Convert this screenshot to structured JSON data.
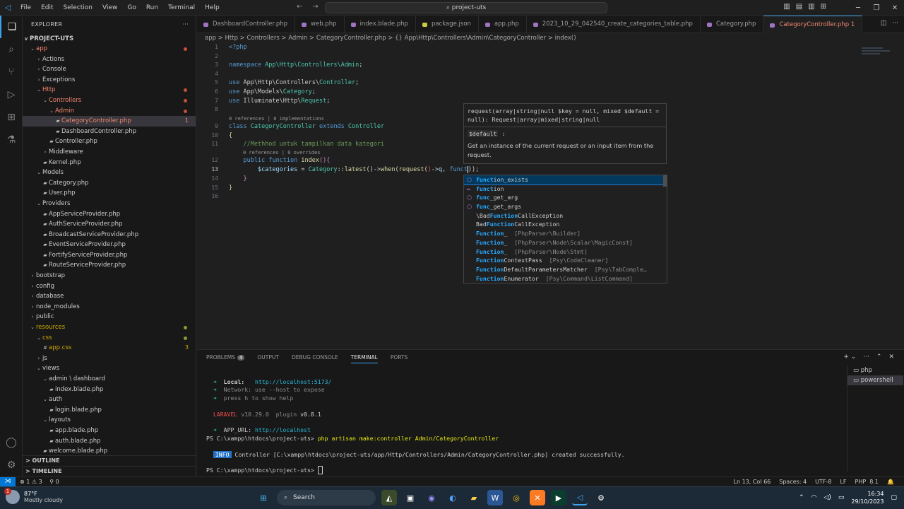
{
  "titlebar": {
    "menu": [
      "File",
      "Edit",
      "Selection",
      "View",
      "Go",
      "Run",
      "Terminal",
      "Help"
    ],
    "search": "project-uts"
  },
  "explorer": {
    "title": "EXPLORER",
    "project": "PROJECT-UTS",
    "tree": [
      {
        "label": "app",
        "indent": 1,
        "chev": "v",
        "cls": "red",
        "dot": "#c74e39"
      },
      {
        "label": "Actions",
        "indent": 2,
        "chev": ">"
      },
      {
        "label": "Console",
        "indent": 2,
        "chev": ">"
      },
      {
        "label": "Exceptions",
        "indent": 2,
        "chev": ">"
      },
      {
        "label": "Http",
        "indent": 2,
        "chev": "v",
        "cls": "red",
        "dot": "#c74e39"
      },
      {
        "label": "Controllers",
        "indent": 3,
        "chev": "v",
        "cls": "red",
        "dot": "#c74e39"
      },
      {
        "label": "Admin",
        "indent": 4,
        "chev": "v",
        "cls": "red",
        "dot": "#c74e39"
      },
      {
        "label": "CategoryController.php",
        "indent": 5,
        "file": "php",
        "cls": "red",
        "num": "1",
        "sel": true
      },
      {
        "label": "DashboardController.php",
        "indent": 5,
        "file": "php"
      },
      {
        "label": "Controller.php",
        "indent": 4,
        "file": "php"
      },
      {
        "label": "Middleware",
        "indent": 3,
        "chev": ">"
      },
      {
        "label": "Kernel.php",
        "indent": 3,
        "file": "php"
      },
      {
        "label": "Models",
        "indent": 2,
        "chev": "v"
      },
      {
        "label": "Category.php",
        "indent": 3,
        "file": "php"
      },
      {
        "label": "User.php",
        "indent": 3,
        "file": "php"
      },
      {
        "label": "Providers",
        "indent": 2,
        "chev": "v"
      },
      {
        "label": "AppServiceProvider.php",
        "indent": 3,
        "file": "php"
      },
      {
        "label": "AuthServiceProvider.php",
        "indent": 3,
        "file": "php"
      },
      {
        "label": "BroadcastServiceProvider.php",
        "indent": 3,
        "file": "php"
      },
      {
        "label": "EventServiceProvider.php",
        "indent": 3,
        "file": "php"
      },
      {
        "label": "FortifyServiceProvider.php",
        "indent": 3,
        "file": "php"
      },
      {
        "label": "RouteServiceProvider.php",
        "indent": 3,
        "file": "php"
      },
      {
        "label": "bootstrap",
        "indent": 1,
        "chev": ">"
      },
      {
        "label": "config",
        "indent": 1,
        "chev": ">"
      },
      {
        "label": "database",
        "indent": 1,
        "chev": ">"
      },
      {
        "label": "node_modules",
        "indent": 1,
        "chev": ">"
      },
      {
        "label": "public",
        "indent": 1,
        "chev": ">"
      },
      {
        "label": "resources",
        "indent": 1,
        "chev": "v",
        "cls": "yel",
        "dot": "#8f9a2e"
      },
      {
        "label": "css",
        "indent": 2,
        "chev": "v",
        "cls": "yel",
        "dot": "#8f9a2e"
      },
      {
        "label": "app.css",
        "indent": 3,
        "file": "css",
        "cls": "yel",
        "num": "3"
      },
      {
        "label": "js",
        "indent": 2,
        "chev": ">"
      },
      {
        "label": "views",
        "indent": 2,
        "chev": "v"
      },
      {
        "label": "admin \\ dashboard",
        "indent": 3,
        "chev": "v"
      },
      {
        "label": "index.blade.php",
        "indent": 4,
        "file": "php"
      },
      {
        "label": "auth",
        "indent": 3,
        "chev": "v"
      },
      {
        "label": "login.blade.php",
        "indent": 4,
        "file": "php"
      },
      {
        "label": "layouts",
        "indent": 3,
        "chev": "v"
      },
      {
        "label": "app.blade.php",
        "indent": 4,
        "file": "php"
      },
      {
        "label": "auth.blade.php",
        "indent": 4,
        "file": "php"
      },
      {
        "label": "welcome.blade.php",
        "indent": 3,
        "file": "php"
      }
    ],
    "outline": "OUTLINE",
    "timeline": "TIMELINE"
  },
  "tabs": [
    {
      "label": "DashboardController.php",
      "kind": "php"
    },
    {
      "label": "web.php",
      "kind": "php"
    },
    {
      "label": "index.blade.php",
      "kind": "php"
    },
    {
      "label": "package.json",
      "kind": "json"
    },
    {
      "label": "app.php",
      "kind": "php"
    },
    {
      "label": "2023_10_29_042540_create_categories_table.php",
      "kind": "php"
    },
    {
      "label": "Category.php",
      "kind": "php"
    },
    {
      "label": "CategoryController.php 1",
      "kind": "php",
      "active": true
    }
  ],
  "breadcrumb": "app > Http > Controllers > Admin > CategoryController.php > {} App\\Http\\Controllers\\Admin\\CategoryController > index()",
  "code": {
    "line_numbers": [
      "1",
      "2",
      "3",
      "4",
      "5",
      "6",
      "7",
      "8",
      "9",
      "10",
      "11",
      "12",
      "13",
      "14",
      "15",
      "16"
    ],
    "codelens1": "0 references | 0 implementations",
    "codelens2": "0 references | 0 overrides"
  },
  "hover": {
    "signature_1": "request(array|string|null $key = null, mixed $default =",
    "signature_2": "null): Request|array|mixed|string|null",
    "param": "$default",
    "doc": "Get an instance of the current request or an input item from the request."
  },
  "suggestions": [
    {
      "pre": "",
      "hl": "funct",
      "post": "ion_exists",
      "det": "",
      "icon": "⬡"
    },
    {
      "pre": "",
      "hl": "funct",
      "post": "ion",
      "det": "",
      "icon": "▭"
    },
    {
      "pre": "",
      "hl": "func",
      "post": "_get_arg",
      "det": "",
      "icon": "⬡"
    },
    {
      "pre": "",
      "hl": "func",
      "post": "_get_args",
      "det": "",
      "icon": "⬡"
    },
    {
      "pre": "\\Bad",
      "hl": "Function",
      "post": "CallException",
      "det": "",
      "icon": ""
    },
    {
      "pre": "Bad",
      "hl": "Function",
      "post": "CallException",
      "det": "",
      "icon": ""
    },
    {
      "pre": "",
      "hl": "Function",
      "post": "_",
      "det": "[PhpParser\\Builder]",
      "icon": ""
    },
    {
      "pre": "",
      "hl": "Function",
      "post": "_",
      "det": "[PhpParser\\Node\\Scalar\\MagicConst]",
      "icon": ""
    },
    {
      "pre": "",
      "hl": "Function",
      "post": "_",
      "det": "[PhpParser\\Node\\Stmt]",
      "icon": ""
    },
    {
      "pre": "",
      "hl": "Function",
      "post": "ContextPass",
      "det": "[Psy\\CodeCleaner]",
      "icon": ""
    },
    {
      "pre": "",
      "hl": "Function",
      "post": "DefaultParametersMatcher",
      "det": "[Psy\\TabComple…",
      "icon": ""
    },
    {
      "pre": "",
      "hl": "Function",
      "post": "Enumerator",
      "det": "[Psy\\Command\\ListCommand]",
      "icon": ""
    }
  ],
  "panel": {
    "tabs": [
      "PROBLEMS",
      "OUTPUT",
      "DEBUG CONSOLE",
      "TERMINAL",
      "PORTS"
    ],
    "problems_count": "4",
    "active_tab": "TERMINAL",
    "shells": [
      "php",
      "powershell"
    ]
  },
  "terminal": {
    "local_label": "Local:",
    "local_url": "http://localhost:5173/",
    "network": "Network: use --host to expose",
    "press": "press h to show help",
    "laravel": "LARAVEL",
    "laravel_ver": "v10.29.0",
    "plugin": "plugin",
    "plugin_ver": "v0.8.1",
    "app_url_label": "APP_URL:",
    "app_url": "http://localhost",
    "prompt1": "PS C:\\xampp\\htdocs\\project-uts>",
    "cmd1": "php artisan make:controller Admin/CategoryController",
    "info": "INFO",
    "info_msg": "Controller [C:\\xampp\\htdocs\\project-uts/app/Http/Controllers/Admin/CategoryController.php] created successfully.",
    "prompt2": "PS C:\\xampp\\htdocs\\project-uts>"
  },
  "status": {
    "errors": "⊗ 1 ⚠ 3",
    "ports": "⚲ 0",
    "position": "Ln 13, Col 66",
    "spaces": "Spaces: 4",
    "encoding": "UTF-8",
    "eol": "LF",
    "lang": "PHP",
    "ver": "8.1"
  },
  "taskbar": {
    "temp": "87°F",
    "weather": "Mostly cloudy",
    "badge": "1",
    "search": "Search",
    "time": "16:34",
    "date": "29/10/2023"
  }
}
